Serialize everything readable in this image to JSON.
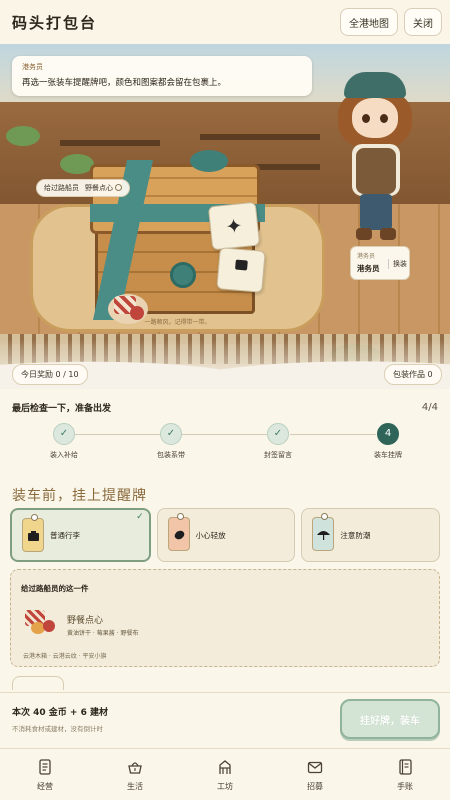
{
  "header": {
    "title": "码头打包台",
    "map_button": "全港地图",
    "close_button": "关闭"
  },
  "scene": {
    "speech": {
      "speaker": "港务员",
      "text": "再选一张装车提醒牌吧，颜色和图案都会留在包裹上。"
    },
    "passenger_chip": {
      "who": "给过路船员",
      "what": "野餐点心"
    },
    "mat_caption": "一路顺风，记得带一带。",
    "staff": {
      "role": "港务员",
      "name": "港务员",
      "switch": "换装"
    },
    "reward_chip": "今日奖励 0 / 10",
    "works_chip": "包装作品 0"
  },
  "progress": {
    "title": "最后检查一下，准备出发",
    "count": "4/4",
    "steps": [
      {
        "label": "装入补给",
        "mark": "✓"
      },
      {
        "label": "包装系带",
        "mark": "✓"
      },
      {
        "label": "封签留言",
        "mark": "✓"
      },
      {
        "label": "装车挂牌",
        "mark": "4"
      }
    ]
  },
  "tags_section": {
    "title": "装车前，挂上提醒牌",
    "options": [
      {
        "label": "普通行李",
        "selected": true,
        "color": "#f0d58c",
        "icon": "box-icon"
      },
      {
        "label": "小心轻放",
        "selected": false,
        "color": "#f2c4a8",
        "icon": "egg-icon"
      },
      {
        "label": "注意防潮",
        "selected": false,
        "color": "#cfe3dc",
        "icon": "umbrella-icon"
      }
    ],
    "check_mark": "✓"
  },
  "gift": {
    "title": "给过路船员的这一件",
    "name": "野餐点心",
    "items": "黄油饼干 · 莓果酱 · 野餐布",
    "tags": "云港木箱 · 云港云纹 · 平安小旗"
  },
  "footer": {
    "cost": "本次 40 金币 + 6 建材",
    "note": "不消耗食材或建材，没有倒计时",
    "ship_button": "挂好牌，装车"
  },
  "nav": {
    "items": [
      {
        "label": "经营",
        "icon": "ledger-icon"
      },
      {
        "label": "生活",
        "icon": "basket-icon"
      },
      {
        "label": "工坊",
        "icon": "workshop-icon"
      },
      {
        "label": "招募",
        "icon": "mail-icon"
      },
      {
        "label": "手账",
        "icon": "notebook-icon"
      }
    ]
  },
  "colors": {
    "accent_green": "#2f6458",
    "strap_teal": "#4a8c86",
    "title_brown": "#8a6b3e"
  }
}
